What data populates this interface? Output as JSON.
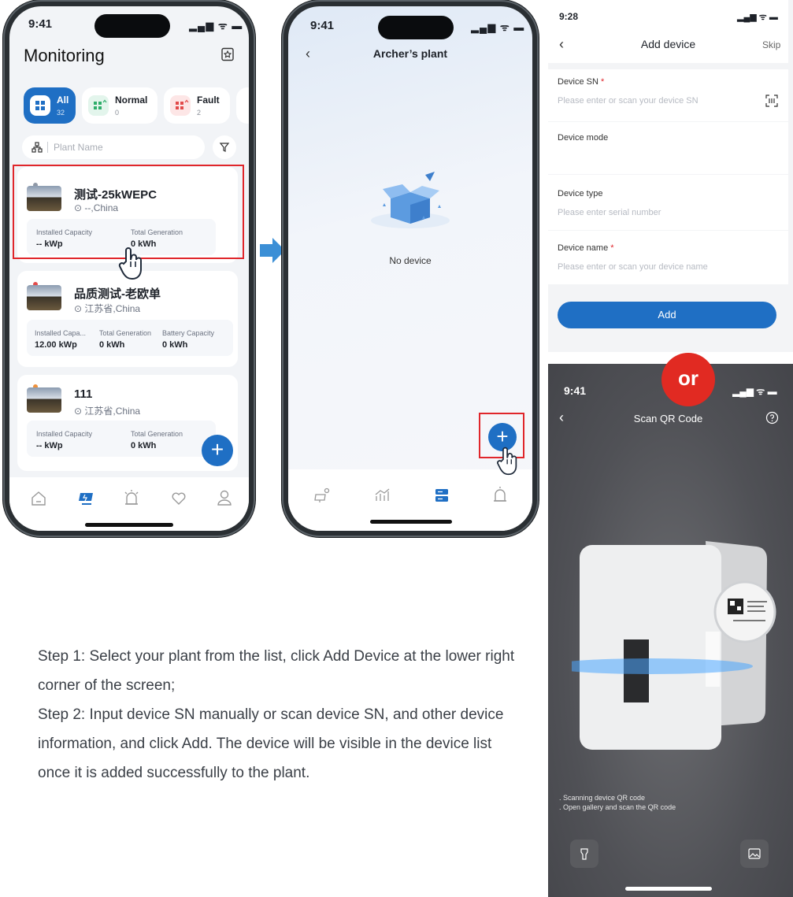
{
  "phone1": {
    "time": "9:41",
    "title": "Monitoring",
    "filters": [
      {
        "label": "All",
        "count": "32"
      },
      {
        "label": "Normal",
        "count": "0"
      },
      {
        "label": "Fault",
        "count": "2"
      }
    ],
    "search_placeholder": "Plant Name",
    "plants": [
      {
        "name": "测试-25kWEPC",
        "location": "--,China",
        "stats": [
          {
            "label": "Installed Capacity",
            "value": "-- kWp"
          },
          {
            "label": "Total Generation",
            "value": "0 kWh"
          }
        ]
      },
      {
        "name": "品质测试-老欧单",
        "location": "江苏省,China",
        "stats": [
          {
            "label": "Installed Capa...",
            "value": "12.00 kWp"
          },
          {
            "label": "Total Generation",
            "value": "0 kWh"
          },
          {
            "label": "Battery Capacity",
            "value": "0 kWh"
          }
        ]
      },
      {
        "name": "111",
        "location": "江苏省,China",
        "stats": [
          {
            "label": "Installed Capacity",
            "value": "-- kWp"
          },
          {
            "label": "Total Generation",
            "value": "0 kWh"
          }
        ]
      }
    ]
  },
  "phone2": {
    "time": "9:41",
    "title": "Archer’s plant",
    "empty_text": "No device"
  },
  "add_device": {
    "time": "9:28",
    "title": "Add device",
    "skip": "Skip",
    "fields": [
      {
        "label": "Device SN",
        "required": "*",
        "placeholder": "Please enter or scan your device SN"
      },
      {
        "label": "Device mode",
        "required": "",
        "placeholder": ""
      },
      {
        "label": "Device type",
        "required": "",
        "placeholder": "Please enter serial number"
      },
      {
        "label": "Device name",
        "required": "*",
        "placeholder": "Please enter or scan your device name"
      }
    ],
    "add_button": "Add"
  },
  "or_badge": "or",
  "scan": {
    "time": "9:41",
    "title": "Scan QR Code",
    "tips": [
      ". Scanning device QR code",
      ". Open gallery and scan the QR code"
    ]
  },
  "instructions": [
    "Step 1: Select your plant from the list, click Add Device at the lower right corner of the screen;",
    "Step 2: Input device SN manually or scan device SN, and other device information, and click Add. The device will be visible in the device list once it is added successfully to the plant."
  ],
  "colors": {
    "accent": "#1f6fc4",
    "highlight": "#e0262b",
    "arrow": "#3b8fd6",
    "or_badge": "#e12a22"
  }
}
